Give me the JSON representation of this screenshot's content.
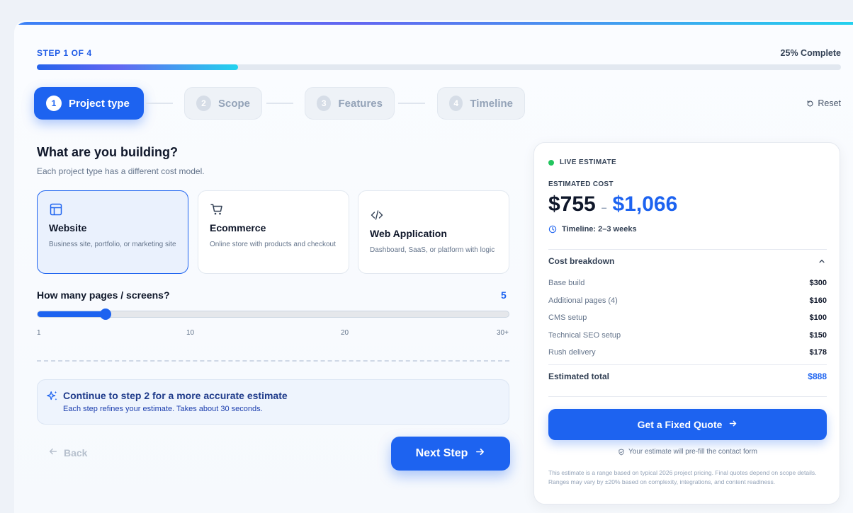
{
  "progress": {
    "step_label": "STEP 1 OF 4",
    "percent_label": "25% Complete",
    "fraction": 0.25
  },
  "stepper": {
    "steps": [
      {
        "num": "1",
        "label": "Project type"
      },
      {
        "num": "2",
        "label": "Scope"
      },
      {
        "num": "3",
        "label": "Features"
      },
      {
        "num": "4",
        "label": "Timeline"
      }
    ],
    "active_index": 0,
    "reset_label": "Reset"
  },
  "question": {
    "title": "What are you building?",
    "subtitle": "Each project type has a different cost model."
  },
  "project_types": [
    {
      "icon": "layout-icon",
      "title": "Website",
      "desc": "Business site, portfolio, or marketing site",
      "selected": true
    },
    {
      "icon": "cart-icon",
      "title": "Ecommerce",
      "desc": "Online store with products and checkout",
      "selected": false
    },
    {
      "icon": "code-icon",
      "title": "Web Application",
      "desc": "Dashboard, SaaS, or platform with logic",
      "selected": false
    }
  ],
  "pages": {
    "label": "How many pages / screens?",
    "value": "5",
    "level_fraction": 0.145,
    "ticks": [
      "1",
      "10",
      "20",
      "30+"
    ]
  },
  "tip": {
    "title": "Continue to step 2 for a more accurate estimate",
    "subtitle": "Each step refines your estimate. Takes about 30 seconds."
  },
  "nav": {
    "back_label": "Back",
    "next_label": "Next Step"
  },
  "estimate": {
    "live_label": "LIVE ESTIMATE",
    "cost_label": "ESTIMATED COST",
    "range_low": "$755",
    "range_sep": "–",
    "range_high": "$1,066",
    "timeline": "Timeline: 2–3 weeks",
    "breakdown_title": "Cost breakdown",
    "items": [
      {
        "name": "Base build",
        "amount": "$300"
      },
      {
        "name": "Additional pages (4)",
        "amount": "$160"
      },
      {
        "name": "CMS setup",
        "amount": "$100"
      },
      {
        "name": "Technical SEO setup",
        "amount": "$150"
      },
      {
        "name": "Rush delivery",
        "amount": "$178"
      }
    ],
    "total_label": "Estimated total",
    "total_amount": "$888",
    "quote_label": "Get a Fixed Quote",
    "prefill_note": "Your estimate will pre-fill the contact form",
    "disclaimer": "This estimate is a range based on typical 2026 project pricing. Final quotes depend on scope details. Ranges may vary by ±20% based on complexity, integrations, and content readiness."
  },
  "colors": {
    "accent": "#1d63f0",
    "live": "#22c55e"
  }
}
